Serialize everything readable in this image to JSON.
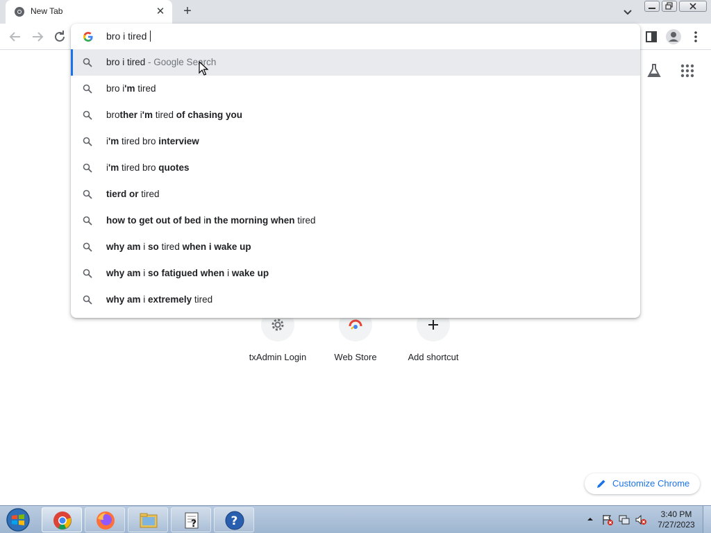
{
  "browser": {
    "tab": {
      "title": "New Tab"
    },
    "omnibox": {
      "text": "bro i tired "
    },
    "suggestions": [
      {
        "parts": [
          {
            "t": "bro i tired",
            "b": false
          },
          {
            "t": " - Google Search",
            "b": false,
            "sep": true
          }
        ],
        "selected": true
      },
      {
        "parts": [
          {
            "t": "bro i",
            "b": false
          },
          {
            "t": "'m",
            "b": true
          },
          {
            "t": " tired",
            "b": false
          }
        ]
      },
      {
        "parts": [
          {
            "t": "bro",
            "b": false
          },
          {
            "t": "ther",
            "b": true
          },
          {
            "t": " i",
            "b": false
          },
          {
            "t": "'m",
            "b": true
          },
          {
            "t": " tired ",
            "b": false
          },
          {
            "t": "of chasing you",
            "b": true
          }
        ]
      },
      {
        "parts": [
          {
            "t": "i",
            "b": false
          },
          {
            "t": "'m",
            "b": true
          },
          {
            "t": " tired bro ",
            "b": false
          },
          {
            "t": "interview",
            "b": true
          }
        ]
      },
      {
        "parts": [
          {
            "t": "i",
            "b": false
          },
          {
            "t": "'m",
            "b": true
          },
          {
            "t": " tired bro ",
            "b": false
          },
          {
            "t": "quotes",
            "b": true
          }
        ]
      },
      {
        "parts": [
          {
            "t": "tierd or",
            "b": true
          },
          {
            "t": " tired",
            "b": false
          }
        ]
      },
      {
        "parts": [
          {
            "t": "how to get out of bed ",
            "b": true
          },
          {
            "t": "i",
            "b": false
          },
          {
            "t": "n the morning when",
            "b": true
          },
          {
            "t": " tired",
            "b": false
          }
        ]
      },
      {
        "parts": [
          {
            "t": "why am",
            "b": true
          },
          {
            "t": " i ",
            "b": false
          },
          {
            "t": "so",
            "b": true
          },
          {
            "t": " tired ",
            "b": false
          },
          {
            "t": "when i wake up",
            "b": true
          }
        ]
      },
      {
        "parts": [
          {
            "t": "why am",
            "b": true
          },
          {
            "t": " i ",
            "b": false
          },
          {
            "t": "so fatigued when",
            "b": true
          },
          {
            "t": " i ",
            "b": false
          },
          {
            "t": "wake up",
            "b": true
          }
        ]
      },
      {
        "parts": [
          {
            "t": "why am",
            "b": true
          },
          {
            "t": " i ",
            "b": false
          },
          {
            "t": "extremely",
            "b": true
          },
          {
            "t": " tired",
            "b": false
          }
        ]
      }
    ]
  },
  "ntp": {
    "shortcuts": [
      {
        "label": "txAdmin Login",
        "icon": "gear-icon"
      },
      {
        "label": "Web Store",
        "icon": "webstore-icon"
      },
      {
        "label": "Add shortcut",
        "icon": "plus-icon"
      }
    ],
    "customize_label": "Customize Chrome"
  },
  "taskbar": {
    "apps": [
      "chrome-icon",
      "firefox-icon",
      "file-manager-icon",
      "notepad-help-icon",
      "help-icon"
    ],
    "clock_time": "3:40 PM",
    "clock_date": "7/27/2023"
  },
  "colors": {
    "accent": "#1a73e8",
    "tabstrip": "#dee1e6",
    "selected_row": "#e8eaed"
  }
}
